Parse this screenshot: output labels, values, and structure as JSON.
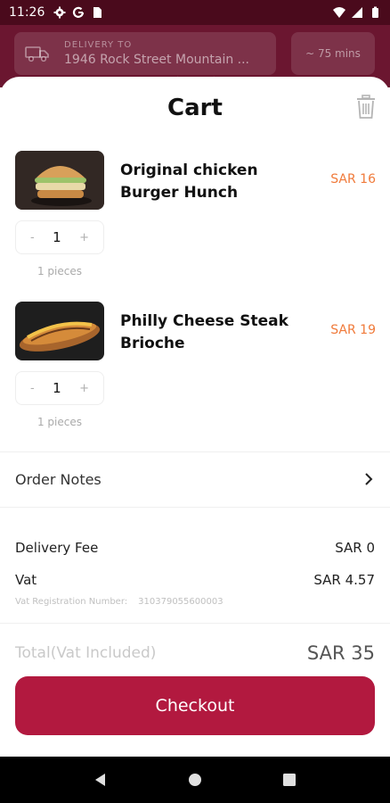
{
  "status_bar": {
    "time": "11:26",
    "left_icons": [
      "gear-icon",
      "google-g-icon",
      "sim-card-icon"
    ],
    "right_icons": [
      "wifi-icon",
      "signal-icon",
      "battery-icon"
    ]
  },
  "header": {
    "delivery_label": "DELIVERY TO",
    "delivery_address": "1946 Rock Street Mountain ...",
    "eta": "~ 75 mins"
  },
  "cart": {
    "title": "Cart",
    "items": [
      {
        "name": "Original chicken Burger Hunch",
        "price": "SAR 16",
        "quantity": "1",
        "minus": "-",
        "plus": "+",
        "pieces": "1 pieces"
      },
      {
        "name": "Philly Cheese Steak Brioche",
        "price": "SAR 19",
        "quantity": "1",
        "minus": "-",
        "plus": "+",
        "pieces": "1 pieces"
      }
    ],
    "order_notes_label": "Order Notes",
    "delivery_fee_label": "Delivery Fee",
    "delivery_fee_value": "SAR 0",
    "vat_label": "Vat",
    "vat_value": "SAR 4.57",
    "vat_reg_label": "Vat Registration Number:",
    "vat_reg_number": "310379055600003",
    "total_label": "Total",
    "total_label_sub": "(Vat Included)",
    "total_value": "SAR 35",
    "checkout_label": "Checkout"
  },
  "colors": {
    "brand": "#b2193f",
    "header": "#6b1630",
    "price": "#f07a3a"
  }
}
